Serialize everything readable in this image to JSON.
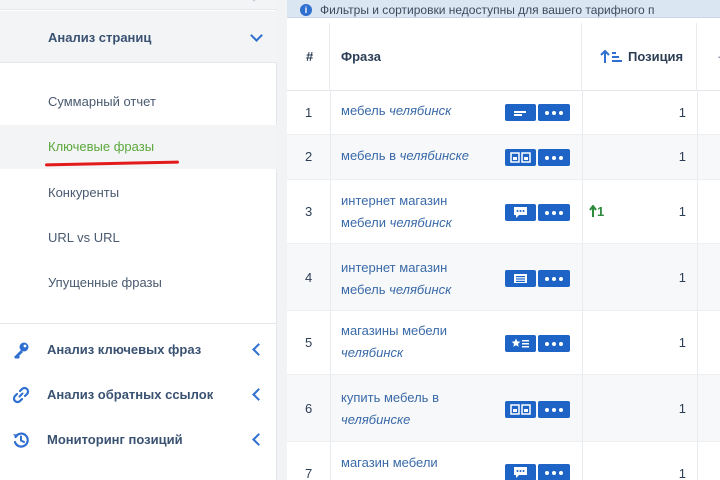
{
  "sidebar": {
    "section": {
      "label": "Анализ страниц"
    },
    "sub_items": [
      {
        "label": "Суммарный отчет",
        "active": false
      },
      {
        "label": "Ключевые фразы",
        "active": true
      },
      {
        "label": "Конкуренты",
        "active": false
      },
      {
        "label": "URL vs URL",
        "active": false
      },
      {
        "label": "Упущенные фразы",
        "active": false
      }
    ],
    "nav_items": [
      {
        "label": "Анализ ключевых фраз",
        "icon": "key-icon"
      },
      {
        "label": "Анализ обратных ссылок",
        "icon": "link-icon"
      },
      {
        "label": "Мониторинг позиций",
        "icon": "monitoring-icon"
      }
    ],
    "colors": {
      "accent": "#2f6fd0",
      "active_text": "#5ca83d",
      "underline": "#e21a1a"
    }
  },
  "main": {
    "info_text": "Фильтры и сортировки недоступны для вашего тарифного п",
    "columns": {
      "num": "#",
      "phrase": "Фраза",
      "position": "Позиция"
    },
    "rows": [
      {
        "num": "1",
        "phrase_plain": "мебель",
        "phrase_italic": "челябинск",
        "icon": "snippet-icon",
        "position": "1",
        "change": ""
      },
      {
        "num": "2",
        "phrase_plain": "мебель в",
        "phrase_italic": "челябинске",
        "icon": "images-icon",
        "position": "1",
        "change": ""
      },
      {
        "num": "3",
        "phrase_plain": "интернет магазин мебели",
        "phrase_italic": "челябинск",
        "icon": "reviews-icon",
        "position": "1",
        "change": "1"
      },
      {
        "num": "4",
        "phrase_plain": "интернет магазин мебель",
        "phrase_italic": "челябинск",
        "icon": "list-icon",
        "position": "1",
        "change": ""
      },
      {
        "num": "5",
        "phrase_plain": "магазины мебели",
        "phrase_italic": "челябинск",
        "icon": "rating-icon",
        "position": "1",
        "change": ""
      },
      {
        "num": "6",
        "phrase_plain": "купить мебель в",
        "phrase_italic": "челябинске",
        "icon": "images-icon",
        "position": "1",
        "change": ""
      },
      {
        "num": "7",
        "phrase_plain": "магазин мебели",
        "phrase_italic": "",
        "icon": "reviews-icon",
        "position": "1",
        "change": ""
      }
    ],
    "colors": {
      "button": "#1e63c6",
      "link": "#3a6aa8",
      "positive": "#2e8b3d"
    }
  }
}
